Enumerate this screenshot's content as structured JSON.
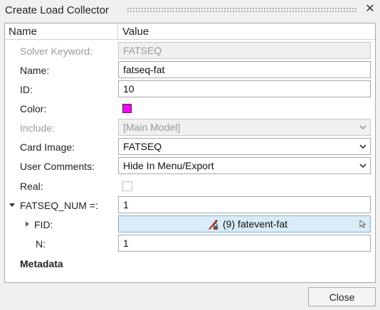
{
  "window": {
    "title": "Create Load Collector"
  },
  "header": {
    "name": "Name",
    "value": "Value"
  },
  "rows": {
    "solver_keyword": {
      "label": "Solver Keyword:",
      "value": "FATSEQ"
    },
    "name": {
      "label": "Name:",
      "value": "fatseq-fat"
    },
    "id": {
      "label": "ID:",
      "value": "10"
    },
    "color": {
      "label": "Color:",
      "swatch": "#ff00ff"
    },
    "include": {
      "label": "Include:",
      "value": "[Main Model]"
    },
    "card_image": {
      "label": "Card Image:",
      "value": "FATSEQ"
    },
    "user_comments": {
      "label": "User Comments:",
      "value": "Hide In Menu/Export"
    },
    "real": {
      "label": "Real:",
      "checked": false
    },
    "fatseq_num": {
      "label": "FATSEQ_NUM =:",
      "value": "1"
    },
    "fid": {
      "label": "FID:",
      "value": "(9) fatevent-fat"
    },
    "n": {
      "label": "N:",
      "value": "1"
    },
    "metadata": {
      "label": "Metadata"
    }
  },
  "footer": {
    "close_label": "Close"
  },
  "icons": {
    "close": "close-x-icon",
    "collapse": "triangle-down-icon",
    "expand": "triangle-right-icon",
    "dropdown": "chevron-down-icon",
    "entity": "fatigue-event-icon",
    "cursor": "cursor-arrow-icon"
  }
}
